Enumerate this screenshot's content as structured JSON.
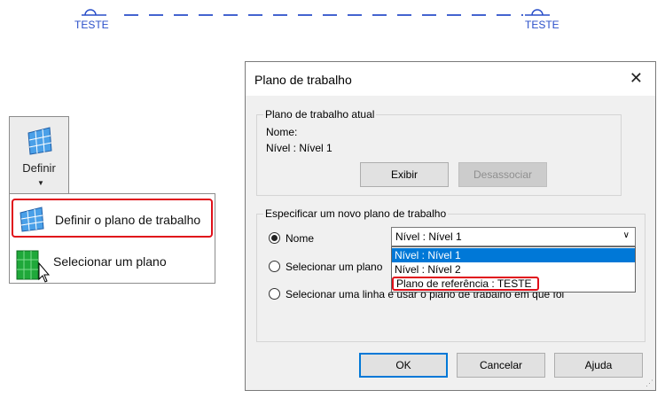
{
  "reference_line": {
    "left_label": "TESTE",
    "right_label": "TESTE",
    "line_color": "#2a4fc9"
  },
  "ribbon": {
    "button_label": "Definir"
  },
  "menu": {
    "items": [
      {
        "label": "Definir o plano de trabalho",
        "icon": "grid-plane-icon",
        "highlighted": true
      },
      {
        "label": "Selecionar um plano",
        "icon": "green-plane-icon",
        "highlighted": false
      }
    ]
  },
  "dialog": {
    "title": "Plano de trabalho",
    "current": {
      "group_title": "Plano de trabalho atual",
      "name_label": "Nome:",
      "name_value": "Nível : Nível 1",
      "show_button": "Exibir",
      "dissociate_button": "Desassociar"
    },
    "new": {
      "group_title": "Especificar um novo plano de trabalho",
      "options": [
        {
          "label": "Nome",
          "selected": true
        },
        {
          "label": "Selecionar um plano",
          "selected": false
        },
        {
          "label": "Selecionar uma linha e usar o plano de trabalho em que foi",
          "selected": false
        }
      ],
      "select_value": "Nível : Nível 1",
      "dropdown_options": [
        {
          "label": "Nível : Nível 1",
          "selected": true
        },
        {
          "label": "Nível : Nível 2",
          "selected": false
        },
        {
          "label": "Plano de referência : TESTE",
          "selected": false,
          "highlighted": true
        }
      ]
    },
    "buttons": {
      "ok": "OK",
      "cancel": "Cancelar",
      "help": "Ajuda"
    },
    "accent_color": "#0078d7",
    "highlight_color": "#e0101a"
  }
}
